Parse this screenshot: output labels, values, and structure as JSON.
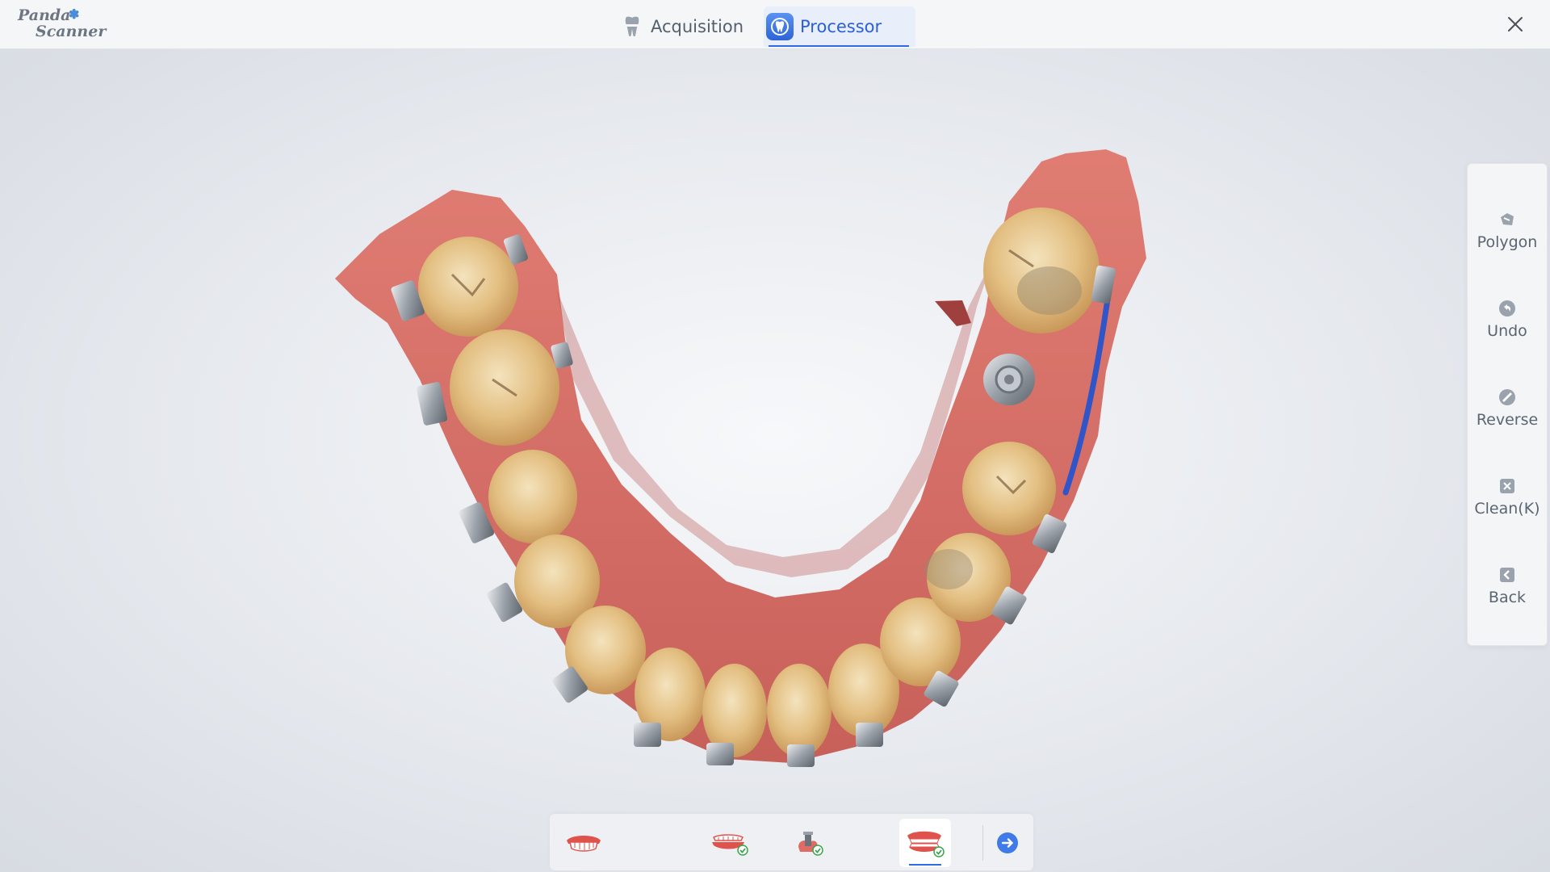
{
  "app": {
    "logo_line1": "Panda",
    "logo_line2": "Scanner"
  },
  "tabs": [
    {
      "label": "Acquisition",
      "icon": "tooth-icon",
      "active": false
    },
    {
      "label": "Processor",
      "icon": "processor-icon",
      "active": true
    }
  ],
  "window": {
    "close_icon": "close-icon"
  },
  "tools": [
    {
      "label": "Polygon",
      "icon": "polygon-icon"
    },
    {
      "label": "Undo",
      "icon": "undo-icon"
    },
    {
      "label": "Reverse",
      "icon": "reverse-icon"
    },
    {
      "label": "Clean(K)",
      "icon": "clean-icon"
    },
    {
      "label": "Back",
      "icon": "back-icon"
    }
  ],
  "bottom_toolbar": {
    "items": [
      {
        "icon": "upper-jaw-icon",
        "checked": false,
        "active": false
      },
      {
        "icon": "lower-jaw-checked-icon",
        "checked": true,
        "active": false
      },
      {
        "icon": "scan-body-checked-icon",
        "checked": true,
        "active": false
      },
      {
        "icon": "bite-checked-icon",
        "checked": true,
        "active": true
      }
    ],
    "next_icon": "next-arrow-icon"
  },
  "colors": {
    "accent": "#2f6be6",
    "gum": "#d9776e",
    "tooth": "#e8c98f",
    "check": "#3aa64a"
  }
}
